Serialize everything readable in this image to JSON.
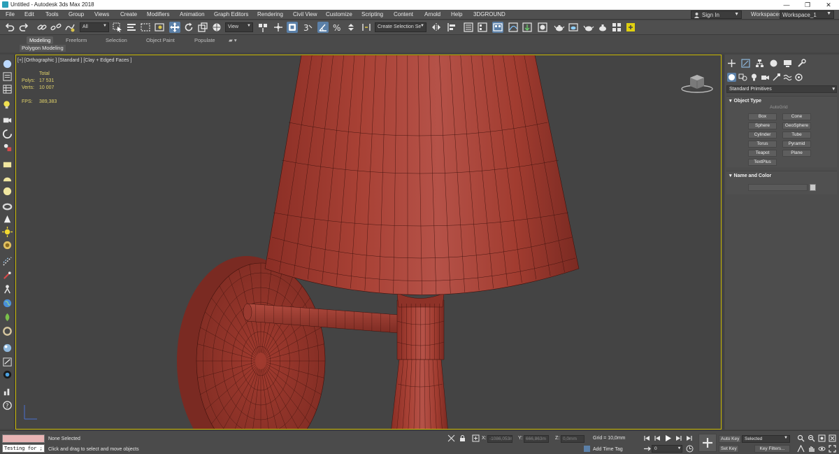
{
  "window": {
    "title": "Untitled - Autodesk 3ds Max 2018",
    "minimize_glyph": "—",
    "maximize_glyph": "❐",
    "close_glyph": "✕"
  },
  "menu": {
    "items": [
      "File",
      "Edit",
      "Tools",
      "Group",
      "Views",
      "Create",
      "Modifiers",
      "Animation",
      "Graph Editors",
      "Rendering",
      "Civil View",
      "Customize",
      "Scripting",
      "Content",
      "Arnold",
      "Help",
      "3DGROUND"
    ],
    "sign_in": "Sign In",
    "workspaces_label": "Workspaces:",
    "workspace_value": "Workspace_1"
  },
  "toolbar": {
    "filter_value": "All",
    "refcoord_value": "View",
    "selection_set_placeholder": "Create Selection Se",
    "angle_snap_label": "3"
  },
  "ribbon": {
    "tabs": [
      "Modeling",
      "Freeform",
      "Selection",
      "Object Paint",
      "Populate"
    ],
    "active_tab": "Modeling",
    "sub_label": "Polygon Modeling"
  },
  "viewport": {
    "label": "[+] [Orthographic ] [Standard ] [Clay + Edged Faces ]",
    "stats": {
      "total_label": "Total",
      "polys_label": "Polys:",
      "polys_value": "17 531",
      "verts_label": "Verts:",
      "verts_value": "10 007",
      "fps_label": "FPS:",
      "fps_value": "389,383"
    },
    "model_color": "#9b3a2f",
    "border_color": "#c8b800"
  },
  "command_panel": {
    "category_value": "Standard Primitives",
    "object_type": {
      "header": "Object Type",
      "autogrid": "AutoGrid",
      "buttons": [
        "Box",
        "Cone",
        "Sphere",
        "GeoSphere",
        "Cylinder",
        "Tube",
        "Torus",
        "Pyramid",
        "Teapot",
        "Plane",
        "TextPlus"
      ]
    },
    "name_color": {
      "header": "Name and Color"
    }
  },
  "status": {
    "maxscript_value": "Testing for ;",
    "selection_status": "None Selected",
    "prompt": "Click and drag to select and move objects",
    "x_label": "X:",
    "x_value": "-1086,053m",
    "y_label": "Y:",
    "y_value": "666,863m",
    "z_label": "Z:",
    "z_value": "0,0mm",
    "grid": "Grid = 10,0mm",
    "add_time_tag": "Add Time Tag",
    "frame_value": "0",
    "auto_key": "Auto Key",
    "set_key": "Set Key",
    "selected_value": "Selected",
    "key_filters": "Key Filters..."
  }
}
